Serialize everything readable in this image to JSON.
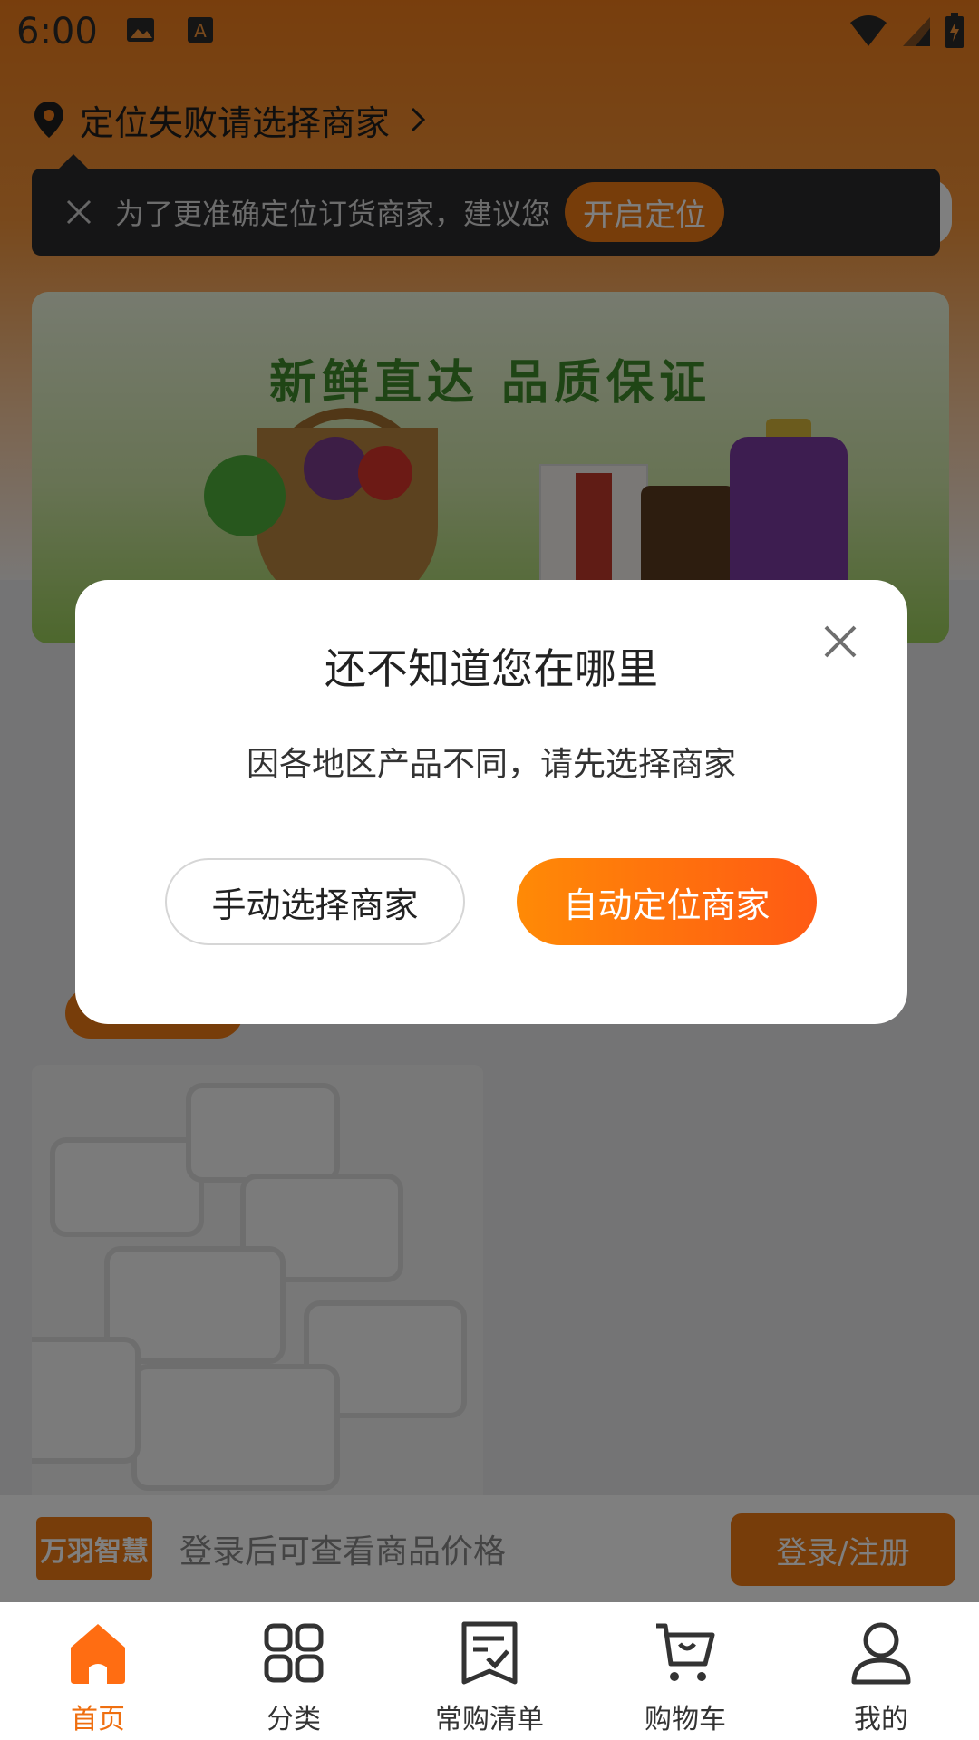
{
  "status_bar": {
    "time": "6:00"
  },
  "location": {
    "text": "定位失败请选择商家"
  },
  "tip": {
    "message": "为了更准确定位订货商家，建议您",
    "button": "开启定位"
  },
  "banner": {
    "title": "新鲜直达 品质保证"
  },
  "login_bar": {
    "logo": "万羽智慧",
    "hint": "登录后可查看商品价格",
    "button": "登录/注册"
  },
  "modal": {
    "title": "还不知道您在哪里",
    "description": "因各地区产品不同，请先选择商家",
    "manual_button": "手动选择商家",
    "auto_button": "自动定位商家"
  },
  "tabs": [
    {
      "label": "首页",
      "icon": "home-icon",
      "active": true
    },
    {
      "label": "分类",
      "icon": "category-icon",
      "active": false
    },
    {
      "label": "常购清单",
      "icon": "list-icon",
      "active": false
    },
    {
      "label": "购物车",
      "icon": "cart-icon",
      "active": false
    },
    {
      "label": "我的",
      "icon": "profile-icon",
      "active": false
    }
  ],
  "colors": {
    "accent": "#ef7a14",
    "accent_gradient_end": "#ff5a14",
    "tip_bg": "#2a2a2c"
  }
}
